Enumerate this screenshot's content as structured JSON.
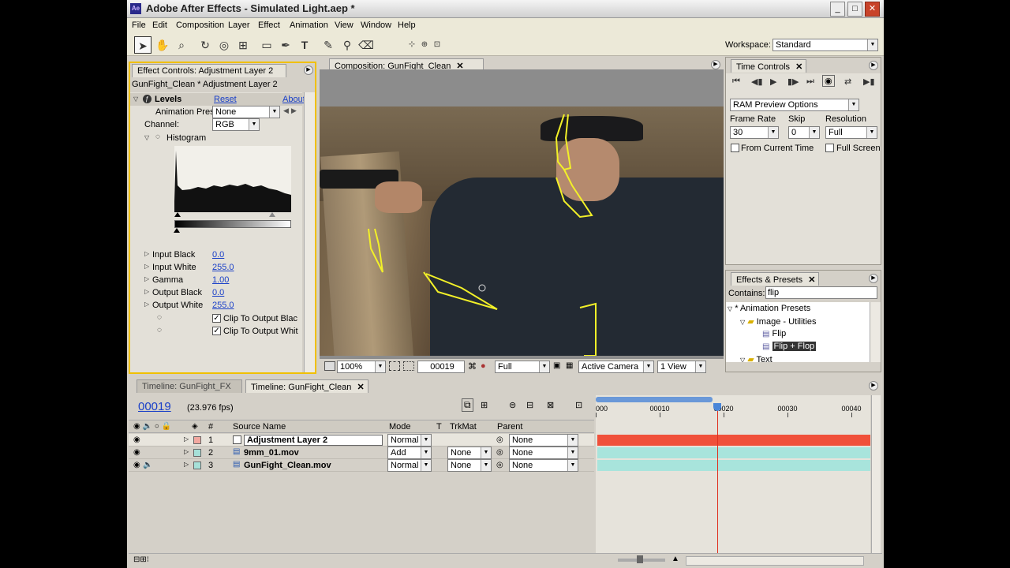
{
  "window": {
    "title": "Adobe After Effects - Simulated Light.aep *",
    "app_icon": "Ae",
    "controls": [
      "minimize",
      "maximize",
      "close"
    ]
  },
  "menu": [
    "File",
    "Edit",
    "Composition",
    "Layer",
    "Effect",
    "Animation",
    "View",
    "Window",
    "Help"
  ],
  "toolbar": {
    "tools": [
      "selection-tool",
      "hand-tool",
      "zoom-tool",
      "rotation-tool",
      "orbit-camera-tool",
      "pan-behind-tool",
      "rectangle-mask-tool",
      "pen-tool",
      "type-tool",
      "brush-tool",
      "clone-stamp-tool",
      "eraser-tool"
    ],
    "workspace_label": "Workspace:",
    "workspace_value": "Standard"
  },
  "effect_controls": {
    "tab_label": "Effect Controls: Adjustment Layer 2",
    "subtitle": "GunFight_Clean * Adjustment Layer 2",
    "effect_name": "Levels",
    "reset": "Reset",
    "about": "About",
    "animation_presets_label": "Animation Pres",
    "animation_presets_value": "None",
    "channel_label": "Channel:",
    "channel_value": "RGB",
    "histogram_label": "Histogram",
    "params": [
      {
        "label": "Input Black",
        "value": "0.0"
      },
      {
        "label": "Input White",
        "value": "255.0"
      },
      {
        "label": "Gamma",
        "value": "1.00"
      },
      {
        "label": "Output Black",
        "value": "0.0"
      },
      {
        "label": "Output White",
        "value": "255.0"
      }
    ],
    "checks": [
      {
        "label": "Clip To Output Blac",
        "checked": true
      },
      {
        "label": "Clip To Output Whit",
        "checked": true
      }
    ]
  },
  "composition": {
    "tab_label": "Composition: GunFight_Clean",
    "zoom": "100%",
    "timecode": "00019",
    "resolution": "Full",
    "camera": "Active Camera",
    "views": "1 View"
  },
  "time_controls": {
    "tab_label": "Time Controls",
    "ram_preview": "RAM Preview Options",
    "frame_rate_label": "Frame Rate",
    "frame_rate_value": "30",
    "skip_label": "Skip",
    "skip_value": "0",
    "resolution_label": "Resolution",
    "resolution_value": "Full",
    "from_current_time": "From Current Time",
    "full_screen": "Full Screen"
  },
  "effects_presets": {
    "tab_label": "Effects & Presets",
    "contains_label": "Contains:",
    "contains_value": "flip",
    "tree": [
      {
        "label": "* Animation Presets",
        "level": 0,
        "type": "folder-open"
      },
      {
        "label": "Image - Utilities",
        "level": 1,
        "type": "folder-open"
      },
      {
        "label": "Flip",
        "level": 2,
        "type": "preset"
      },
      {
        "label": "Flip + Flop",
        "level": 2,
        "type": "preset",
        "selected": true
      },
      {
        "label": "Text",
        "level": 1,
        "type": "folder"
      }
    ]
  },
  "timeline": {
    "tabs": [
      {
        "label": "Timeline: GunFight_FX",
        "active": false
      },
      {
        "label": "Timeline: GunFight_Clean",
        "active": true
      }
    ],
    "current_time": "00019",
    "fps": "(23.976 fps)",
    "columns": {
      "num": "#",
      "source": "Source Name",
      "mode": "Mode",
      "t": "T",
      "trkmat": "TrkMat",
      "parent": "Parent"
    },
    "ruler_ticks": [
      "000",
      "00010",
      "00020",
      "00030",
      "00040"
    ],
    "current_frame": 19,
    "total_frames": 43,
    "layers": [
      {
        "num": "1",
        "name": "Adjustment Layer 2",
        "mode": "Normal",
        "trkmat": "",
        "parent": "None",
        "label_color": "#f2a8a0",
        "bar_color": "#f0503a",
        "audio": false
      },
      {
        "num": "2",
        "name": "9mm_01.mov",
        "mode": "Add",
        "trkmat": "None",
        "parent": "None",
        "label_color": "#a6e0d8",
        "bar_color": "#a8e4dc",
        "audio": false
      },
      {
        "num": "3",
        "name": "GunFight_Clean.mov",
        "mode": "Normal",
        "trkmat": "None",
        "parent": "None",
        "label_color": "#a6e0d8",
        "bar_color": "#a8e4dc",
        "audio": true
      }
    ]
  }
}
